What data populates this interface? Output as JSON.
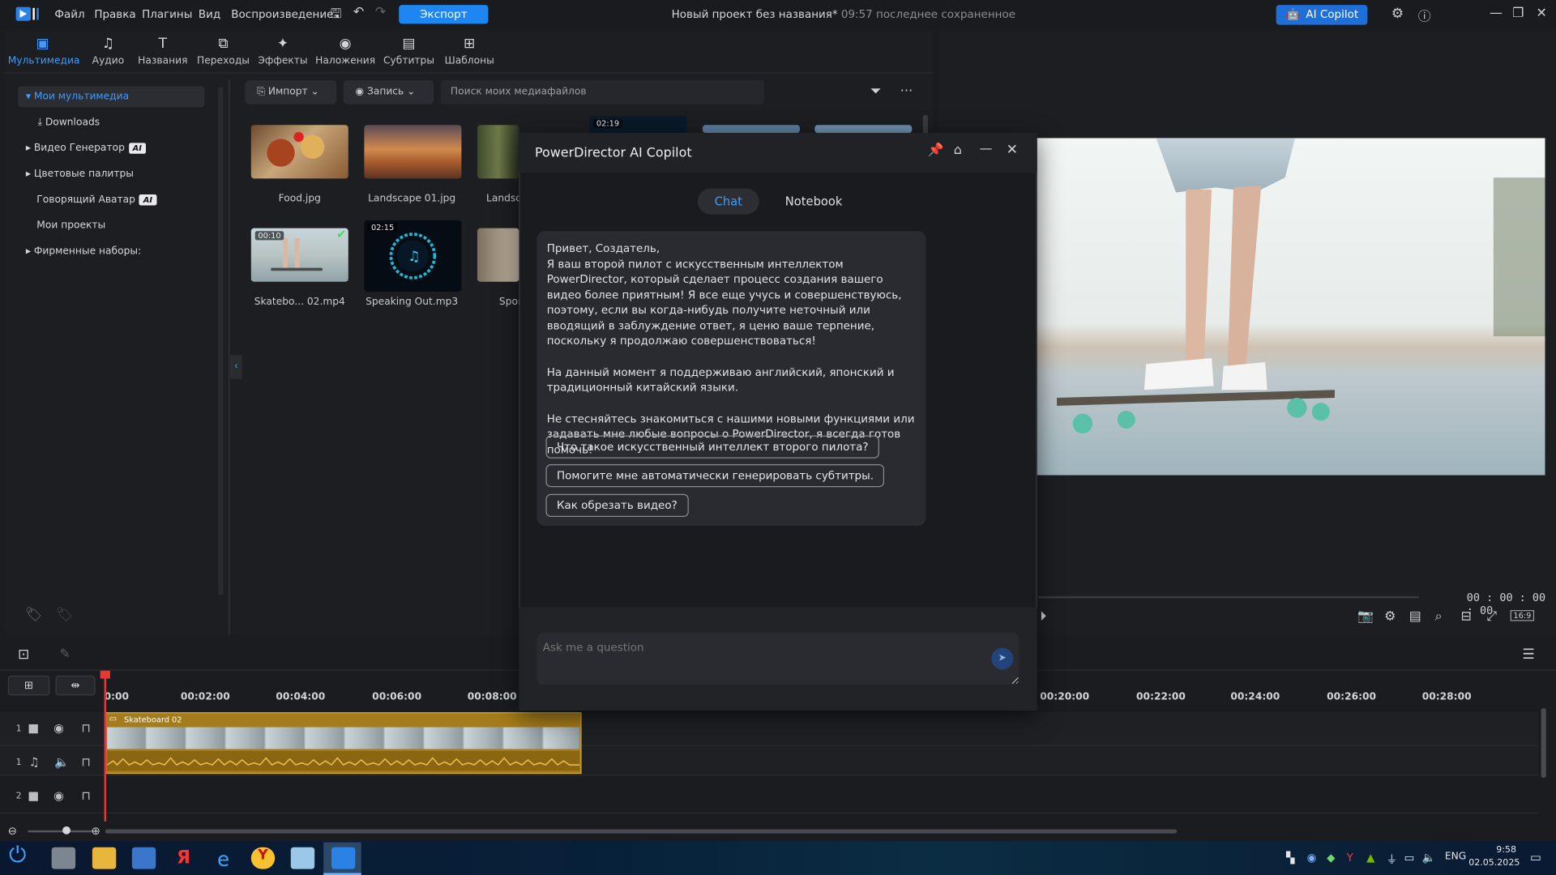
{
  "app": {
    "menu": [
      "Файл",
      "Правка",
      "Плагины",
      "Вид",
      "Воспроизведение"
    ],
    "export_label": "Экспорт",
    "project_title": "Новый проект без названия*",
    "project_saved": "09:57 последнее сохраненное",
    "copilot_label": "AI Copilot"
  },
  "library": {
    "tabs": [
      "Мультимедиа",
      "Аудио",
      "Названия",
      "Переходы",
      "Эффекты",
      "Наложения",
      "Субтитры",
      "Шаблоны"
    ],
    "tree": {
      "my_media": "Мои мультимедиа",
      "downloads": "Downloads",
      "video_gen": "Видео Генератор",
      "palettes": "Цветовые палитры",
      "avatar": "Говорящий Аватар",
      "projects": "Мои проекты",
      "brand": "Фирменные наборы:",
      "ai_badge": "AI"
    },
    "toolbar": {
      "import": "Импорт",
      "record": "Запись",
      "search_placeholder": "Поиск моих медиафайлов"
    },
    "media": [
      {
        "name": "Food.jpg",
        "duration": ""
      },
      {
        "name": "Landscape 01.jpg",
        "duration": ""
      },
      {
        "name": "Landsc",
        "duration": ""
      },
      {
        "name": "",
        "duration": "02:19"
      },
      {
        "name": "Skatebo... 02.mp4",
        "duration": "00:10"
      },
      {
        "name": "Speaking Out.mp3",
        "duration": "02:15"
      },
      {
        "name": "Spor",
        "duration": ""
      }
    ]
  },
  "preview": {
    "timecode": "00 : 00 : 00 : 00",
    "ratio": "16:9"
  },
  "timeline": {
    "ticks": [
      "0:00",
      "00:02:00",
      "00:04:00",
      "00:06:00",
      "00:08:00",
      "00:20:00",
      "00:22:00",
      "00:24:00",
      "00:26:00",
      "00:28:00"
    ],
    "clip_name": "Skateboard 02",
    "track_numbers": [
      "1",
      "1",
      "2"
    ]
  },
  "copilot": {
    "title": "PowerDirector AI Copilot",
    "tab_chat": "Chat",
    "tab_notebook": "Notebook",
    "message": [
      "Привет, Создатель,",
      "Я ваш второй пилот с искусственным интеллектом PowerDirector, который сделает процесс создания вашего видео более приятным! Я все еще учусь и совершенствуюсь, поэтому, если вы когда-нибудь получите неточный или вводящий в заблуждение ответ, я ценю ваше терпение, поскольку я продолжаю совершенствоваться!",
      "На данный момент я поддерживаю английский, японский и традиционный китайский языки.",
      "Не стесняйтесь знакомиться с нашими новыми функциями или задавать мне любые вопросы о PowerDirector, я всегда готов помочь!"
    ],
    "suggestions": [
      "Что такое искусственный интеллект второго пилота?",
      "Помогите мне автоматически генерировать субтитры.",
      "Как обрезать видео?"
    ],
    "input_placeholder": "Ask me a question"
  },
  "taskbar": {
    "lang": "ENG",
    "time": "9:58",
    "date": "02.05.2025"
  }
}
